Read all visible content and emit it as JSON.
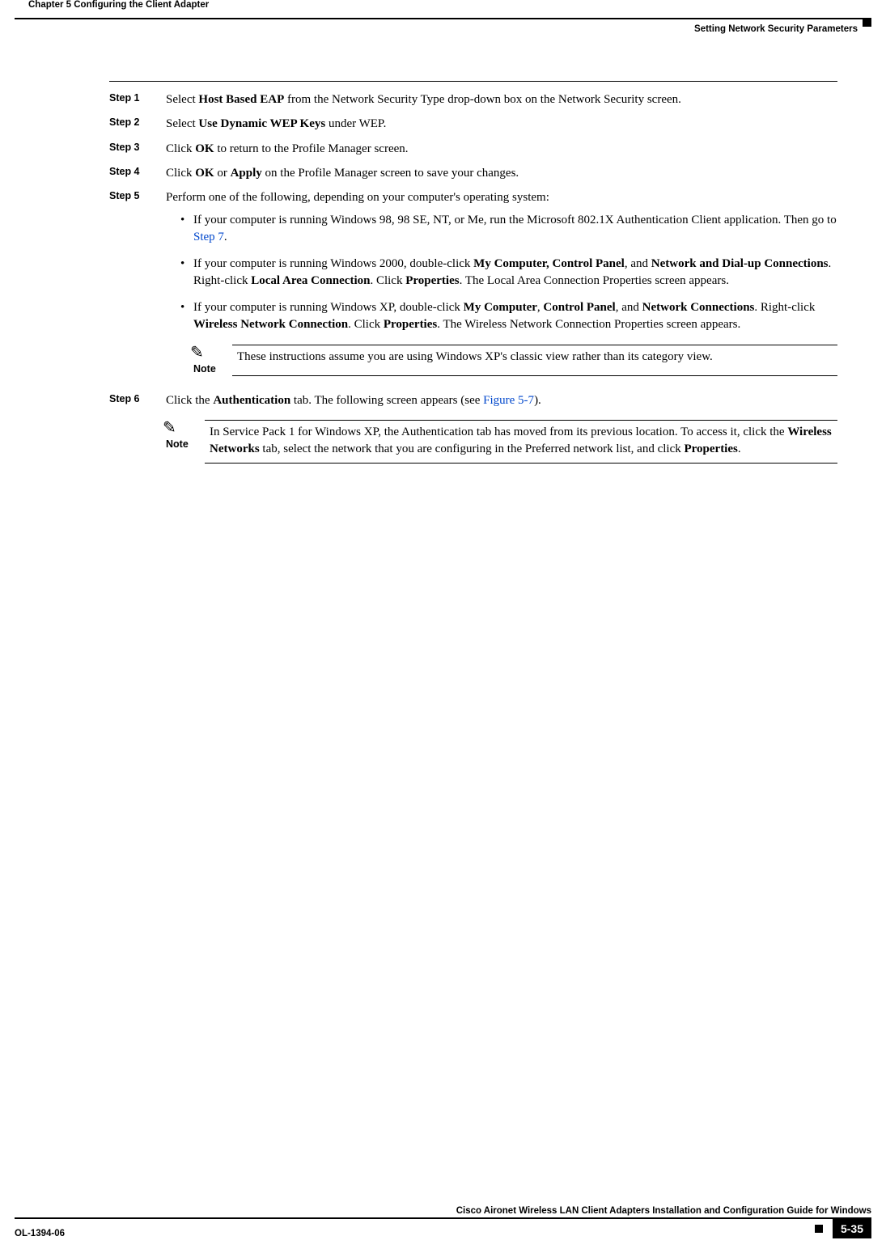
{
  "header": {
    "left": "Chapter 5      Configuring the Client Adapter",
    "right": "Setting Network Security Parameters"
  },
  "steps": {
    "s1": {
      "label": "Step 1",
      "pre": "Select ",
      "bold1": "Host Based EAP",
      "post1": " from the Network Security Type drop-down box on the Network Security screen."
    },
    "s2": {
      "label": "Step 2",
      "pre": "Select ",
      "bold1": "Use Dynamic WEP Keys",
      "post1": " under WEP."
    },
    "s3": {
      "label": "Step 3",
      "pre": "Click ",
      "bold1": "OK",
      "post1": " to return to the Profile Manager screen."
    },
    "s4": {
      "label": "Step 4",
      "pre": "Click ",
      "bold1": "OK",
      "mid": " or ",
      "bold2": "Apply",
      "post1": " on the Profile Manager screen to save your changes."
    },
    "s5": {
      "label": "Step 5",
      "text": "Perform one of the following, depending on your computer's operating system:",
      "b1": {
        "t1": "If your computer is running Windows 98, 98 SE, NT, or Me, run the Microsoft 802.1X Authentication Client application. Then go to  ",
        "link": "Step 7",
        "t2": "."
      },
      "b2": {
        "t1": "If your computer is running Windows 2000, double-click ",
        "bold1": "My Computer, Control Panel",
        "t2": ", and ",
        "bold2": "Network and Dial-up Connections",
        "t3": ". Right-click ",
        "bold3": "Local Area Connection",
        "t4": ". Click ",
        "bold4": "Properties",
        "t5": ". The Local Area Connection Properties screen appears."
      },
      "b3": {
        "t1": "If your computer is running Windows XP, double-click ",
        "bold1": "My Computer",
        "t2": ", ",
        "bold2": "Control Panel",
        "t3": ", and ",
        "bold3": "Network Connections",
        "t4": ". Right-click ",
        "bold4": "Wireless Network Connection",
        "t5": ". Click ",
        "bold5": "Properties",
        "t6": ". The Wireless Network Connection Properties screen appears."
      },
      "note": {
        "label": "Note",
        "text": "These instructions assume you are using Windows XP's classic view rather than its category view."
      }
    },
    "s6": {
      "label": "Step 6",
      "pre": "Click the ",
      "bold1": "Authentication",
      "mid": " tab. The following screen appears (see ",
      "link": "Figure 5-7",
      "post1": ").",
      "note": {
        "label": "Note",
        "t1": "In Service Pack 1 for Windows XP, the Authentication tab has moved from its previous location. To access it, click the ",
        "bold1": "Wireless Networks",
        "t2": " tab, select the network that you are configuring in the Preferred network list, and click ",
        "bold2": "Properties",
        "t3": "."
      }
    }
  },
  "footer": {
    "title": "Cisco Aironet Wireless LAN Client Adapters Installation and Configuration Guide for Windows",
    "doc": "OL-1394-06",
    "page": "5-35"
  }
}
